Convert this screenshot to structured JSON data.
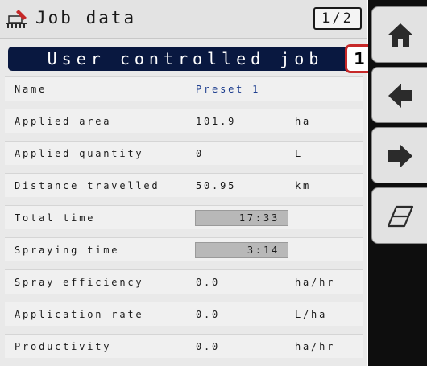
{
  "header": {
    "title": "Job data",
    "page_indicator": "1/2",
    "app_icon": "sprayer-icon"
  },
  "job_banner": "User controlled job",
  "callout": "1",
  "rows": [
    {
      "label": "Name",
      "value": "Preset 1",
      "unit": ""
    },
    {
      "label": "Applied area",
      "value": "101.9",
      "unit": "ha"
    },
    {
      "label": "Applied quantity",
      "value": "0",
      "unit": "L"
    },
    {
      "label": "Distance travelled",
      "value": "50.95",
      "unit": "km"
    },
    {
      "label": "Total time",
      "value": "17:33",
      "unit": ""
    },
    {
      "label": "Spraying time",
      "value": "3:14",
      "unit": ""
    },
    {
      "label": "Spray efficiency",
      "value": "0.0",
      "unit": "ha/hr"
    },
    {
      "label": "Application rate",
      "value": "0.0",
      "unit": "L/ha"
    },
    {
      "label": "Productivity",
      "value": "0.0",
      "unit": "ha/hr"
    }
  ],
  "nav": {
    "buttons": [
      "home-icon",
      "back-arrow-icon",
      "forward-arrow-icon",
      "eraser-icon"
    ]
  },
  "colors": {
    "banner_bg": "#091840",
    "callout_border": "#c62828",
    "name_value": "#1f3f8f",
    "nav_bg": "#0e0e0e"
  }
}
